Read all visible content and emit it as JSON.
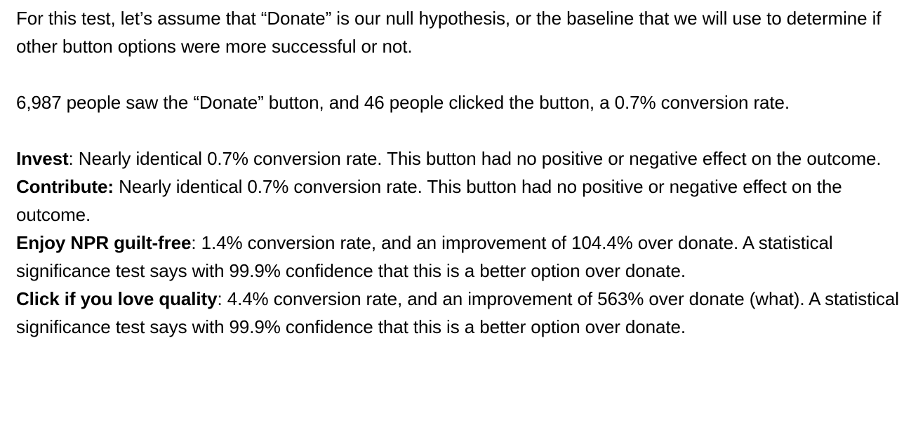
{
  "intro": {
    "text": "For this test, let’s assume that “Donate” is our null hypothesis, or the baseline that we will use to determine if other button options were more successful or not."
  },
  "baseline": {
    "text": "6,987 people saw the “Donate” button, and 46 people clicked the button, a 0.7% conversion rate."
  },
  "results": [
    {
      "term": "Invest",
      "text": ": Nearly identical 0.7% conversion rate. This button had no positive or negative effect on the outcome."
    },
    {
      "term": "Contribute:",
      "text": " Nearly identical 0.7% conversion rate. This button had no positive or negative effect on the outcome."
    },
    {
      "term": "Enjoy NPR guilt-free",
      "text": ": 1.4% conversion rate, and an improvement of 104.4% over donate. A statistical significance test says with 99.9% confidence that this is a better option over donate."
    },
    {
      "term": "Click if you love quality",
      "text": ": 4.4% conversion rate, and an improvement of 563% over donate (what). A statistical significance test says with 99.9% confidence that this is a better option over donate."
    }
  ]
}
